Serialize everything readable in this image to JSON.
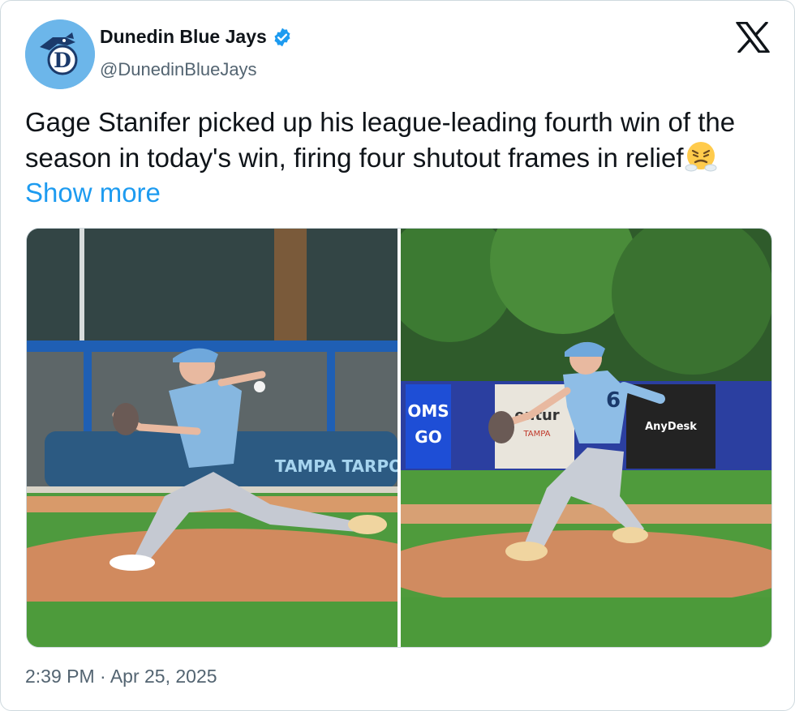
{
  "account": {
    "name": "Dunedin Blue Jays",
    "handle": "@DunedinBlueJays",
    "verified": true,
    "avatar_letter": "D"
  },
  "tweet": {
    "text": "Gage Stanifer picked up his league-leading fourth win of the season in today's win, firing four shutout frames in relief",
    "emoji": "face-with-steam-from-nose",
    "show_more": "Show more",
    "timestamp": "2:39 PM · Apr 25, 2025"
  },
  "media": {
    "left": {
      "banner_text": "TAMPA TARPONS"
    },
    "right": {
      "sign_oms": "OMS",
      "sign_go": "GO",
      "sign_center": "entur",
      "sign_center_sub": "TAMPA",
      "sign_anydesk": "AnyDesk",
      "jersey_number": "6"
    }
  },
  "colors": {
    "link": "#1d9bf0",
    "secondary_text": "#536471",
    "verified": "#1d9bf0",
    "avatar_bg": "#6cb6ea"
  },
  "icons": [
    "x-logo-icon",
    "verified-badge-icon",
    "blue-jay-logo-icon"
  ]
}
